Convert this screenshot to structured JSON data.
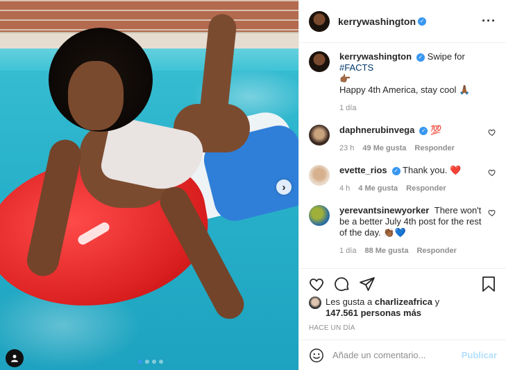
{
  "post": {
    "username": "kerrywashington",
    "verified": true
  },
  "caption": {
    "username": "kerrywashington",
    "text_prefix": "Swipe for",
    "hashtag": "#FACTS",
    "emoji_line": "👉🏾",
    "body": "Happy 4th America, stay cool 🙏🏾",
    "time": "1 día"
  },
  "comments": [
    {
      "username": "daphnerubinvega",
      "verified": true,
      "text": "💯",
      "time": "23 h",
      "likes": "49 Me gusta",
      "reply": "Responder"
    },
    {
      "username": "evette_rios",
      "verified": true,
      "text": "Thank you. ❤️",
      "time": "4 h",
      "likes": "4 Me gusta",
      "reply": "Responder"
    },
    {
      "username": "yerevantsinewyorker",
      "verified": false,
      "text": "There won't be a better July 4th post for the rest of the day. 👏🏾💙",
      "time": "1 día",
      "likes": "88 Me gusta",
      "reply": "Responder"
    }
  ],
  "likes": {
    "prefix": "Les gusta a",
    "user": "charlizeafrica",
    "connector": "y",
    "others": "147.561 personas más"
  },
  "time_ago": "HACE UN DÍA",
  "comment_box": {
    "placeholder": "Añade un comentario...",
    "publish": "Publicar"
  },
  "carousel": {
    "slides": 4,
    "active_index": 0
  },
  "colors": {
    "accent": "#3897f0",
    "publish_disabled": "#b2dffc",
    "secondary_text": "#8e8e8e",
    "heart_red": "#ed4956"
  },
  "icons": {
    "emoji": "smiley-icon",
    "like": "heart-icon",
    "comment": "comment-bubble-icon",
    "share": "paper-plane-icon",
    "save": "bookmark-icon",
    "more": "ellipsis-icon",
    "next": "chevron-right-icon",
    "tag": "user-tag-icon"
  }
}
